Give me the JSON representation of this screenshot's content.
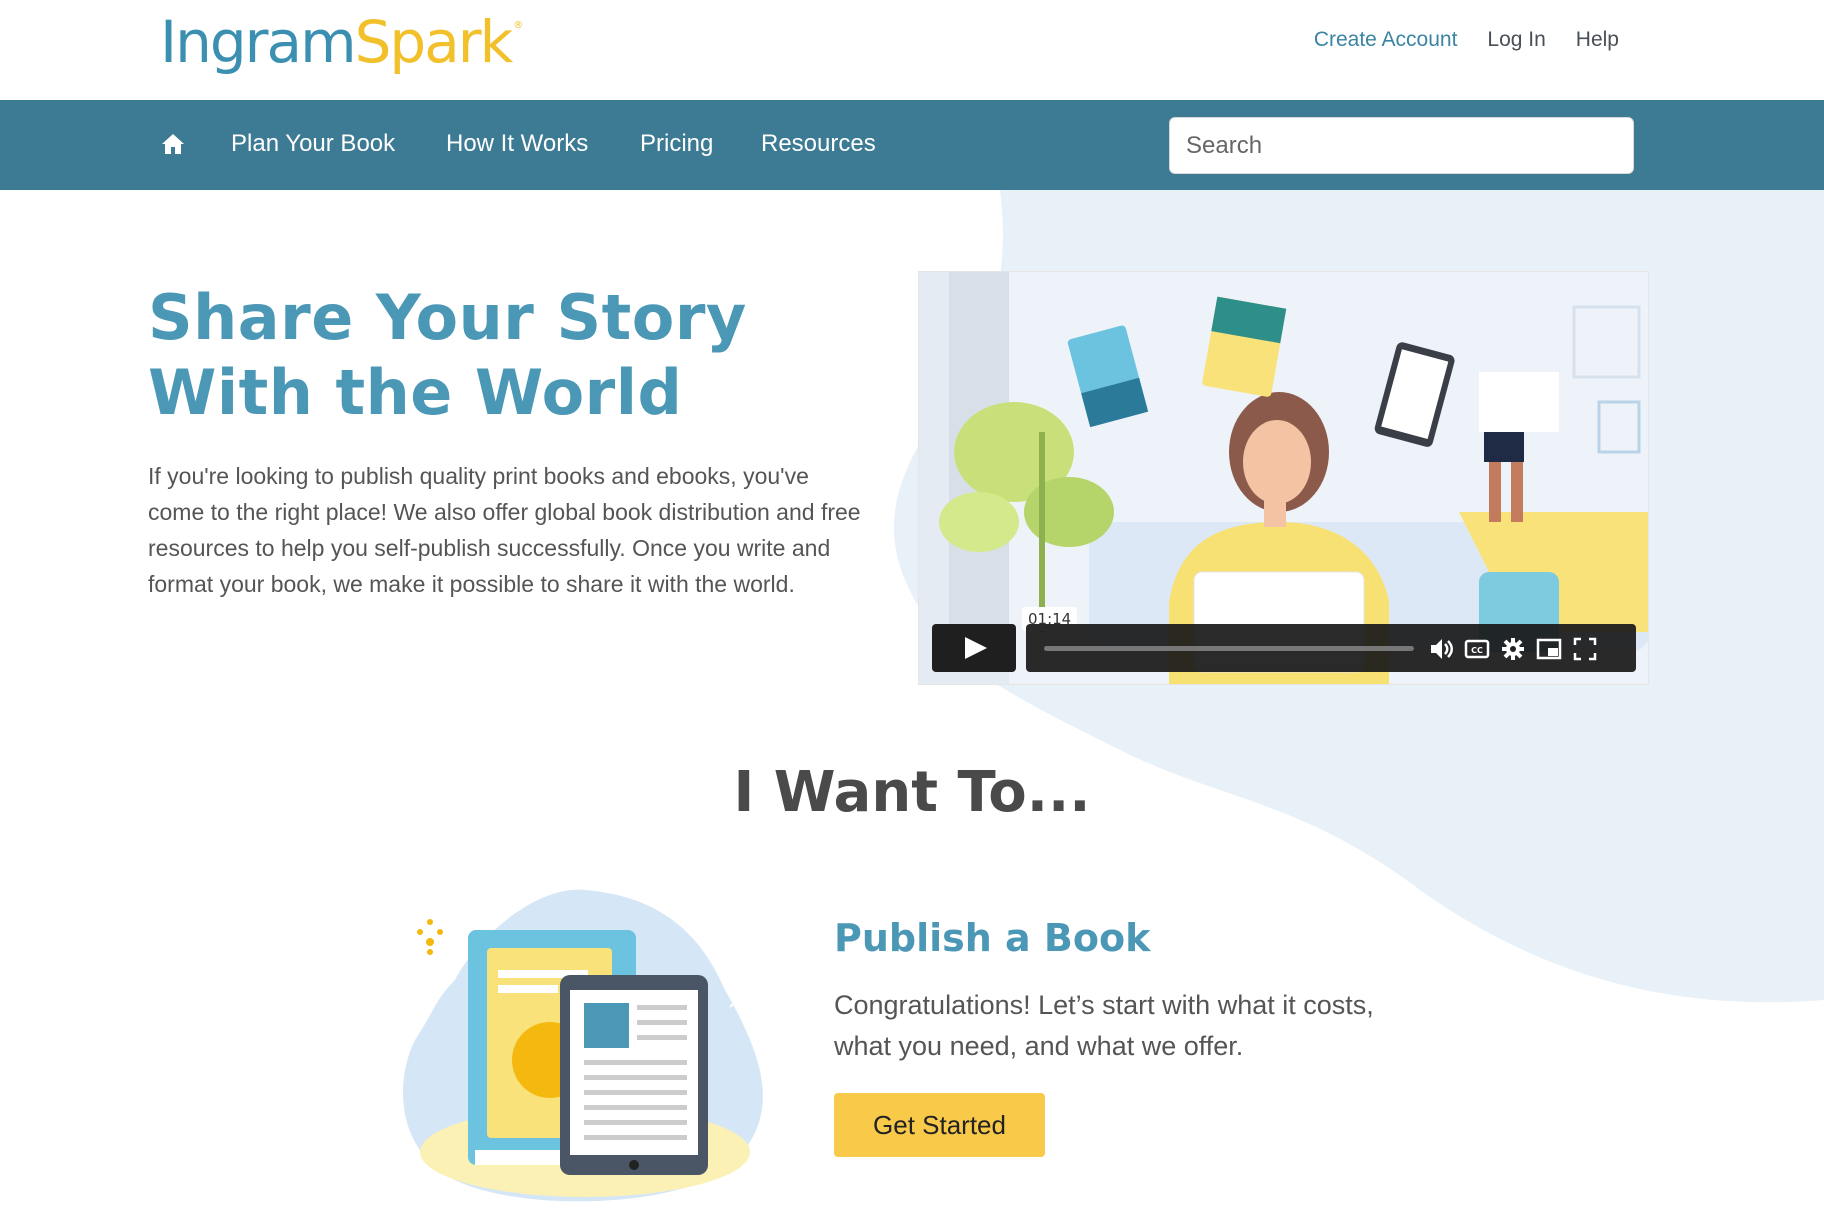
{
  "header": {
    "logo_part1": "Ingram",
    "logo_part2": "Spark",
    "logo_mark": "®",
    "links": {
      "create_account": "Create Account",
      "log_in": "Log In",
      "help": "Help"
    }
  },
  "nav": {
    "home_icon": "home-icon",
    "items": [
      "Plan Your Book",
      "How It Works",
      "Pricing",
      "Resources"
    ],
    "search_placeholder": "Search"
  },
  "hero": {
    "title": "Share Your Story With the World",
    "body": "If you're looking to publish quality print books and ebooks, you've come to the right place! We also offer global book distribution and free resources to help you self-publish successfully. Once you write and format your book, we make it possible to share it with the world."
  },
  "video": {
    "time_tooltip": "01:14",
    "controls": [
      "play-icon",
      "volume-icon",
      "closed-captions-icon",
      "settings-icon",
      "picture-in-picture-icon",
      "fullscreen-icon"
    ]
  },
  "want": {
    "heading": "I Want To..."
  },
  "publish": {
    "title": "Publish a Book",
    "body": "Congratulations! Let’s start with what it costs, what you need, and what we offer.",
    "button": "Get Started"
  },
  "colors": {
    "nav_bg": "#3d7a93",
    "accent_blue": "#4b97b6",
    "logo_yellow": "#f2c02b",
    "button_yellow": "#f9c94a",
    "blob_bg": "#e8f1f8"
  }
}
